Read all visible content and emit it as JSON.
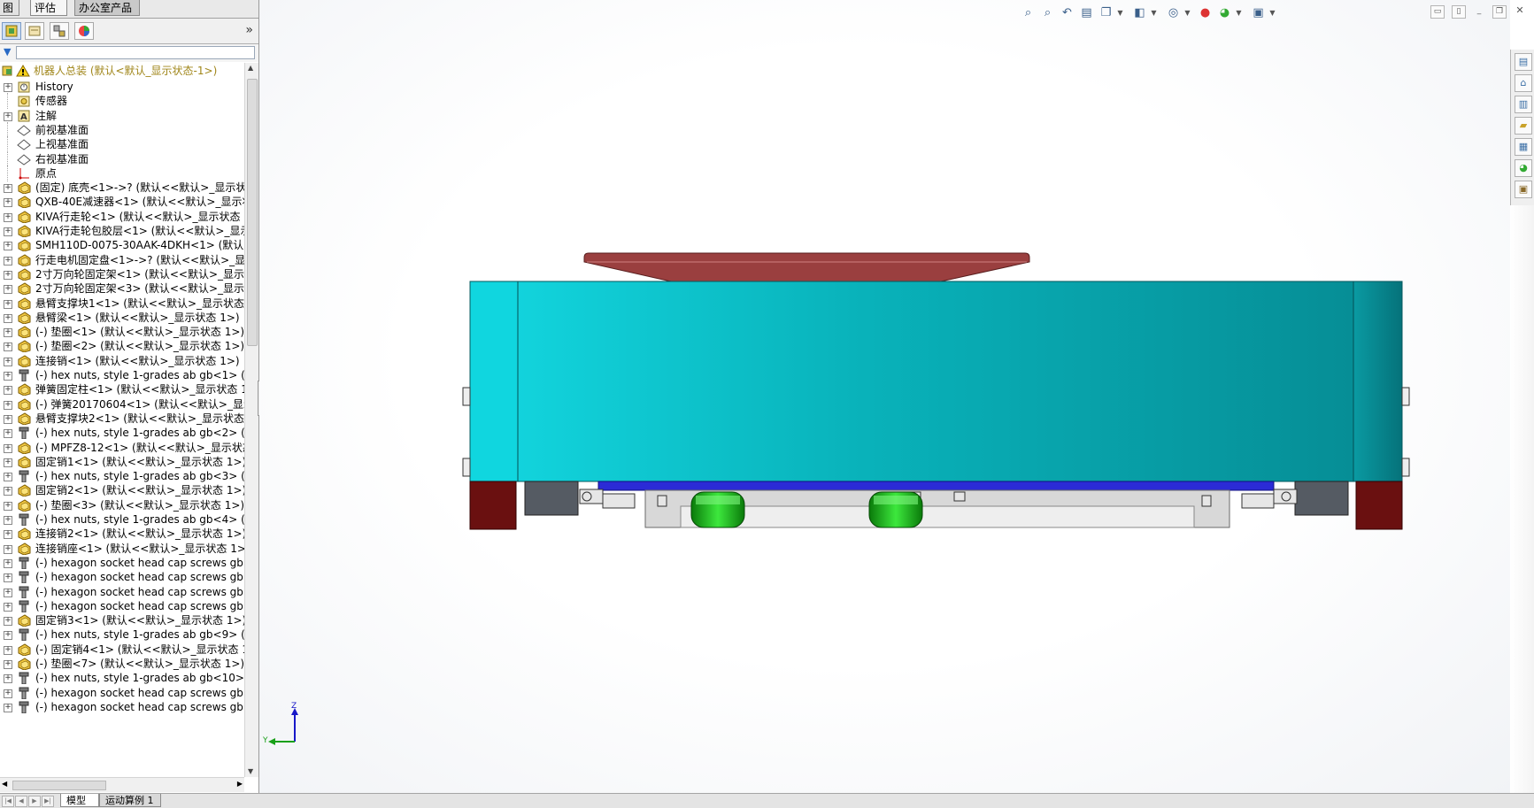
{
  "command_tabs": [
    "图",
    "评估",
    "办公室产品"
  ],
  "tree": {
    "root_label": "机器人总装  (默认<默认_显示状态-1>)",
    "items": [
      {
        "label": "History",
        "expand": true,
        "icon": "history-folder-icon"
      },
      {
        "label": "传感器",
        "expand": false,
        "icon": "sensor-folder-icon"
      },
      {
        "label": "注解",
        "expand": true,
        "icon": "annotation-icon"
      },
      {
        "label": "前视基准面",
        "expand": false,
        "icon": "plane-icon"
      },
      {
        "label": "上视基准面",
        "expand": false,
        "icon": "plane-icon"
      },
      {
        "label": "右视基准面",
        "expand": false,
        "icon": "plane-icon"
      },
      {
        "label": "原点",
        "expand": false,
        "icon": "origin-icon"
      },
      {
        "label": "(固定) 底壳<1>->? (默认<<默认>_显示状态",
        "expand": true,
        "icon": "part-icon"
      },
      {
        "label": "QXB-40E减速器<1> (默认<<默认>_显示状",
        "expand": true,
        "icon": "part-icon"
      },
      {
        "label": "KIVA行走轮<1> (默认<<默认>_显示状态 1",
        "expand": true,
        "icon": "part-icon"
      },
      {
        "label": "KIVA行走轮包胶层<1> (默认<<默认>_显示",
        "expand": true,
        "icon": "part-icon"
      },
      {
        "label": "SMH110D-0075-30AAK-4DKH<1> (默认<",
        "expand": true,
        "icon": "part-icon"
      },
      {
        "label": "行走电机固定盘<1>->? (默认<<默认>_显示",
        "expand": true,
        "icon": "part-icon"
      },
      {
        "label": "2寸万向轮固定架<1> (默认<<默认>_显示状",
        "expand": true,
        "icon": "part-icon"
      },
      {
        "label": "2寸万向轮固定架<3> (默认<<默认>_显示状",
        "expand": true,
        "icon": "part-icon"
      },
      {
        "label": "悬臂支撑块1<1> (默认<<默认>_显示状态 1",
        "expand": true,
        "icon": "part-icon"
      },
      {
        "label": "悬臂梁<1> (默认<<默认>_显示状态 1>)",
        "expand": true,
        "icon": "part-icon"
      },
      {
        "label": "(-) 垫圈<1> (默认<<默认>_显示状态 1>)",
        "expand": true,
        "icon": "part-icon"
      },
      {
        "label": "(-) 垫圈<2> (默认<<默认>_显示状态 1>)",
        "expand": true,
        "icon": "part-icon"
      },
      {
        "label": "连接销<1> (默认<<默认>_显示状态 1>)",
        "expand": true,
        "icon": "part-icon"
      },
      {
        "label": "(-) hex nuts, style 1-grades ab gb<1> (G",
        "expand": true,
        "icon": "toolbox-part-icon"
      },
      {
        "label": "弹簧固定柱<1> (默认<<默认>_显示状态 1:",
        "expand": true,
        "icon": "part-icon"
      },
      {
        "label": "(-) 弹簧20170604<1> (默认<<默认>_显示",
        "expand": true,
        "icon": "part-icon"
      },
      {
        "label": "悬臂支撑块2<1> (默认<<默认>_显示状态 1",
        "expand": true,
        "icon": "part-icon"
      },
      {
        "label": "(-) hex nuts, style 1-grades ab gb<2> (G",
        "expand": true,
        "icon": "toolbox-part-icon"
      },
      {
        "label": "(-) MPFZ8-12<1> (默认<<默认>_显示状态",
        "expand": true,
        "icon": "part-icon"
      },
      {
        "label": "固定销1<1> (默认<<默认>_显示状态 1>)",
        "expand": true,
        "icon": "part-icon"
      },
      {
        "label": "(-) hex nuts, style 1-grades ab gb<3> (G",
        "expand": true,
        "icon": "toolbox-part-icon"
      },
      {
        "label": "固定销2<1> (默认<<默认>_显示状态 1>)",
        "expand": true,
        "icon": "part-icon"
      },
      {
        "label": "(-) 垫圈<3> (默认<<默认>_显示状态 1>)",
        "expand": true,
        "icon": "part-icon"
      },
      {
        "label": "(-) hex nuts, style 1-grades ab gb<4> (G",
        "expand": true,
        "icon": "toolbox-part-icon"
      },
      {
        "label": "连接销2<1> (默认<<默认>_显示状态 1>)",
        "expand": true,
        "icon": "part-icon"
      },
      {
        "label": "连接销座<1> (默认<<默认>_显示状态 1>)",
        "expand": true,
        "icon": "part-icon"
      },
      {
        "label": "(-) hexagon socket head cap screws gb<",
        "expand": true,
        "icon": "toolbox-part-icon"
      },
      {
        "label": "(-) hexagon socket head cap screws gb<",
        "expand": true,
        "icon": "toolbox-part-icon"
      },
      {
        "label": "(-) hexagon socket head cap screws gb<",
        "expand": true,
        "icon": "toolbox-part-icon"
      },
      {
        "label": "(-) hexagon socket head cap screws gb<",
        "expand": true,
        "icon": "toolbox-part-icon"
      },
      {
        "label": "固定销3<1> (默认<<默认>_显示状态 1>)",
        "expand": true,
        "icon": "part-icon"
      },
      {
        "label": "(-) hex nuts, style 1-grades ab gb<9> (G",
        "expand": true,
        "icon": "toolbox-part-icon"
      },
      {
        "label": "(-) 固定销4<1> (默认<<默认>_显示状态 1:",
        "expand": true,
        "icon": "part-icon"
      },
      {
        "label": "(-) 垫圈<7> (默认<<默认>_显示状态 1>)",
        "expand": true,
        "icon": "part-icon"
      },
      {
        "label": "(-) hex nuts, style 1-grades ab gb<10> (",
        "expand": true,
        "icon": "toolbox-part-icon"
      },
      {
        "label": "(-) hexagon socket head cap screws gb<",
        "expand": true,
        "icon": "toolbox-part-icon"
      },
      {
        "label": "(-) hexagon socket head cap screws gb<",
        "expand": true,
        "icon": "toolbox-part-icon"
      }
    ]
  },
  "bottom_tabs": [
    "模型",
    "运动算例 1"
  ],
  "triad": {
    "z": "Z",
    "y": "Y"
  },
  "colors": {
    "body_teal": "#07a5ad",
    "top_plate": "#8e3a3a",
    "wheel_green": "#22c022",
    "bumper_red": "#6a1010",
    "rail_blue": "#2b2bd6"
  }
}
